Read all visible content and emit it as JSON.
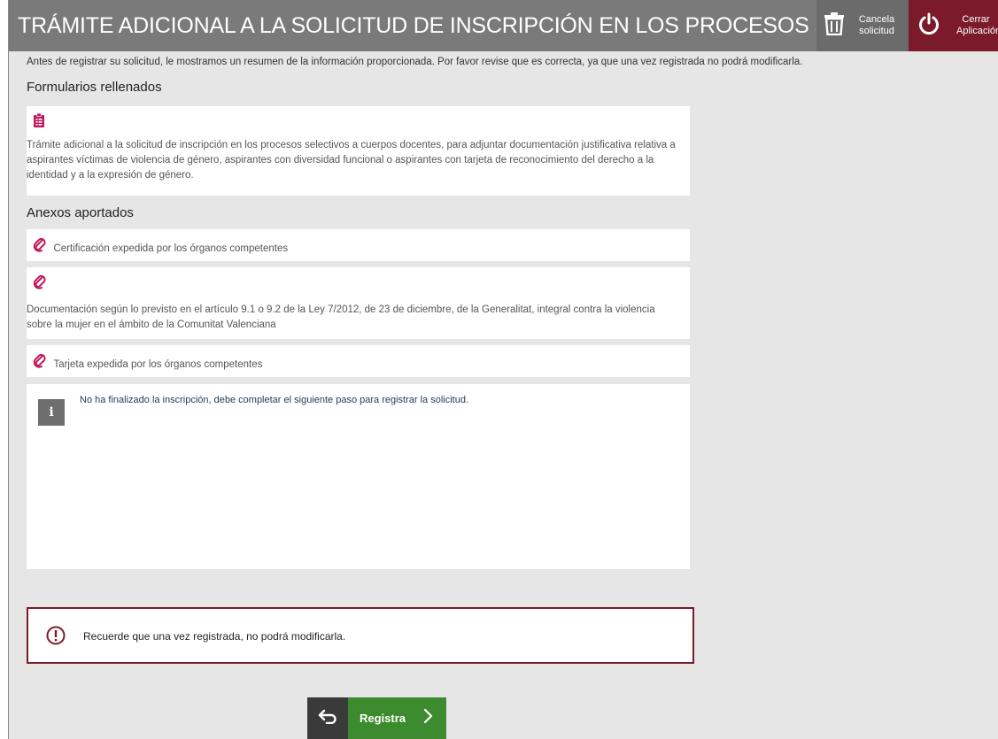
{
  "header": {
    "title": "TRÁMITE ADICIONAL A LA SOLICITUD DE INSCRIPCIÓN EN LOS PROCESOS SELECTIVOS A CUERPOS DOCENTES",
    "cancel_label_1": "Cancela",
    "cancel_label_2": "solicitud",
    "close_label_1": "Cerrar",
    "close_label_2": "Aplicación"
  },
  "intro": "Antes de registrar su solicitud, le mostramos un resumen de la información proporcionada. Por favor revise que es correcta, ya que una vez registrada no podrá modificarla.",
  "forms": {
    "title": "Formularios rellenados",
    "items": [
      {
        "text": "Trámite adicional a la solicitud de inscripción en los procesos selectivos a cuerpos docentes, para adjuntar documentación justificativa relativa a aspirantes víctimas de violencia de género, aspirantes con diversidad funcional o aspirantes con tarjeta de reconocimiento del derecho a la identidad y a la expresión de género."
      }
    ]
  },
  "annexes": {
    "title": "Anexos aportados",
    "items": [
      {
        "text": "Certificación expedida por los órganos competentes"
      },
      {
        "text": "Documentación según lo previsto en el artículo 9.1 o 9.2 de la Ley 7/2012, de 23 de diciembre, de la Generalitat, integral contra la violencia sobre la mujer en el ámbito de la Comunitat Valenciana"
      },
      {
        "text": "Tarjeta expedida por los órganos competentes"
      }
    ]
  },
  "info": {
    "icon_glyph": "i",
    "text": "No ha finalizado la inscripción, debe completar el siguiente paso para registrar la solicitud."
  },
  "warning": {
    "text": "Recuerde que una vez registrada, no podrá modificarla."
  },
  "actions": {
    "register_label": "Registra"
  },
  "colors": {
    "header_bg": "#7a7a7a",
    "close_bg": "#7a1a2a",
    "register_bg": "#3d8b2f",
    "accent": "#c2185b"
  }
}
